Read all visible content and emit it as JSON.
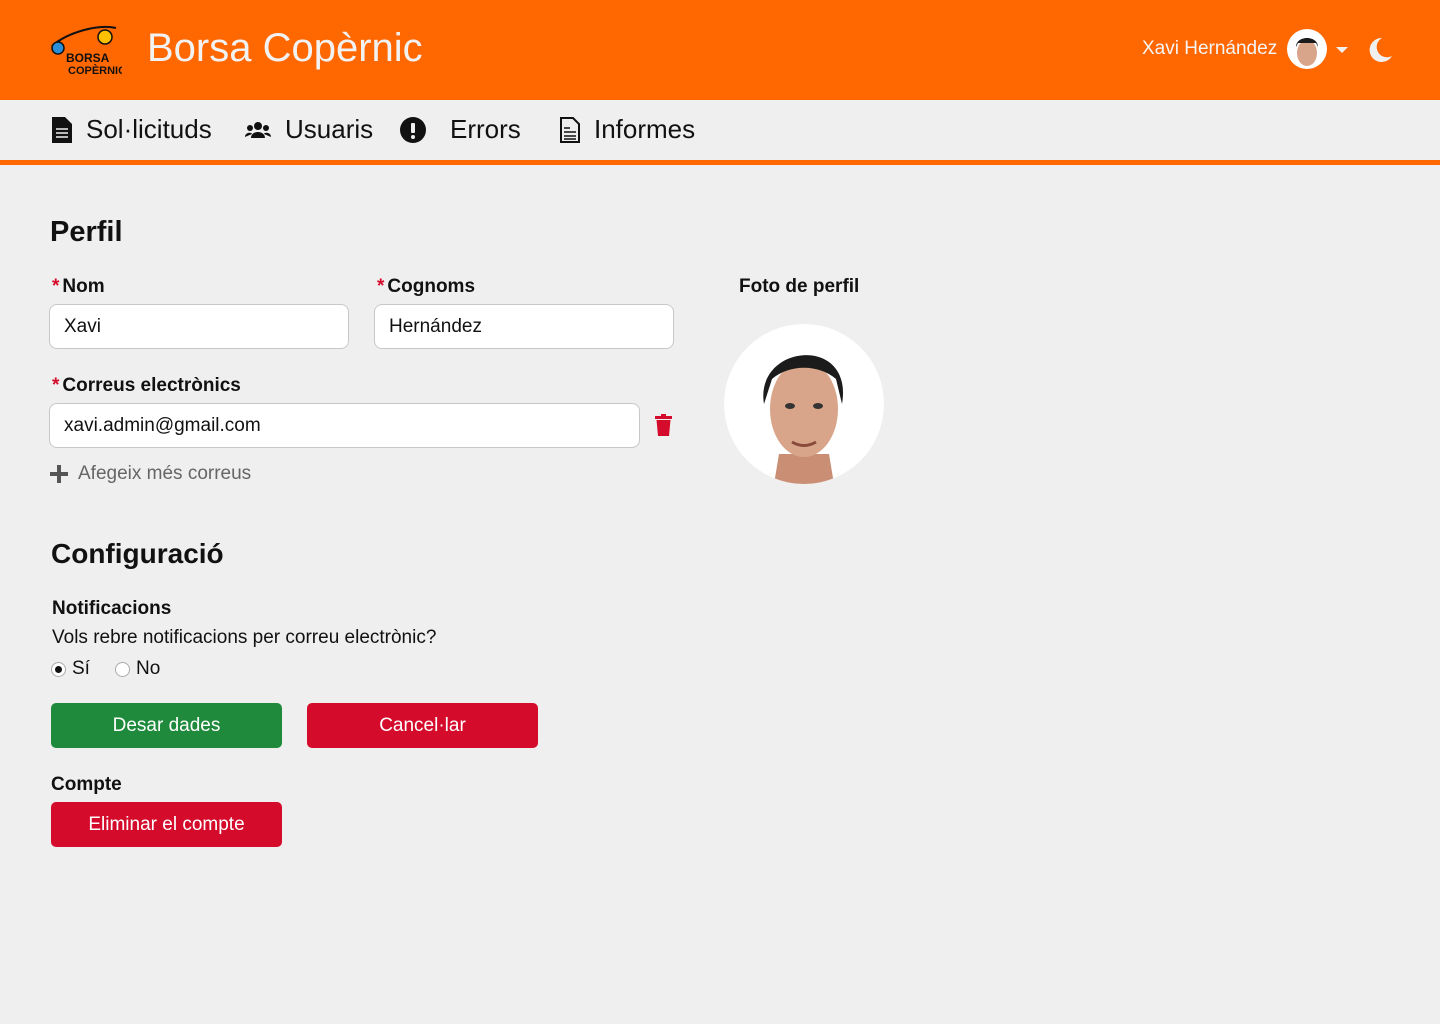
{
  "header": {
    "app_title": "Borsa Copèrnic",
    "logo_text": "Borsa Copèrnic",
    "user_name": "Xavi Hernández"
  },
  "nav": {
    "items": [
      {
        "label": "Sol·licituds",
        "icon": "file-icon"
      },
      {
        "label": "Usuaris",
        "icon": "users-icon"
      },
      {
        "label": "Errors",
        "icon": "exclamation-circle-icon"
      },
      {
        "label": "Informes",
        "icon": "report-icon"
      }
    ]
  },
  "profile": {
    "title": "Perfil",
    "first_name_label": "Nom",
    "first_name_value": "Xavi",
    "last_name_label": "Cognoms",
    "last_name_value": "Hernández",
    "emails_label": "Correus electrònics",
    "emails": [
      "xavi.admin@gmail.com"
    ],
    "add_email_label": "Afegeix més correus",
    "photo_label": "Foto de perfil",
    "required_marker": "*"
  },
  "config": {
    "title": "Configuració",
    "notifications_label": "Notificacions",
    "notifications_question": "Vols rebre notificacions per correu electrònic?",
    "options": [
      {
        "label": "Sí",
        "selected": true
      },
      {
        "label": "No",
        "selected": false
      }
    ],
    "save_label": "Desar dades",
    "cancel_label": "Cancel·lar",
    "account_label": "Compte",
    "delete_account_label": "Eliminar el compte"
  },
  "colors": {
    "brand": "#ff6700",
    "save": "#1f8a3c",
    "danger": "#d50b2b"
  }
}
